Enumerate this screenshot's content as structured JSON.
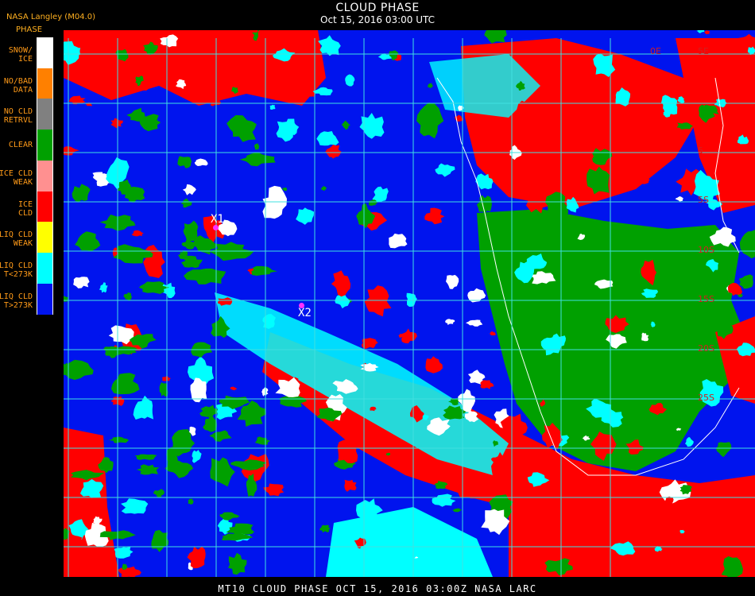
{
  "header": {
    "title": "CLOUD PHASE",
    "subtitle": "Oct 15, 2016 03:00 UTC",
    "producer": "NASA Langley (M04.0)"
  },
  "legend": {
    "heading": "PHASE",
    "items": [
      {
        "label": "SNOW/ ICE",
        "color": "#ffffff"
      },
      {
        "label": "NO/BAD DATA",
        "color": "#ff8000"
      },
      {
        "label": "NO CLD RETRVL",
        "color": "#808080"
      },
      {
        "label": "CLEAR",
        "color": "#00a000"
      },
      {
        "label": "ICE CLD WEAK",
        "color": "#ff9090"
      },
      {
        "label": "ICE CLD",
        "color": "#ff0000"
      },
      {
        "label": "LIQ CLD WEAK",
        "color": "#ffff00"
      },
      {
        "label": "LIQ CLD T<273K",
        "color": "#00ffff"
      },
      {
        "label": "LIQ CLD T>273K",
        "color": "#0014ee"
      }
    ]
  },
  "map": {
    "markers": [
      {
        "label": "X1",
        "color": "#ff30ff"
      },
      {
        "label": "X2",
        "color": "#ff30ff"
      }
    ],
    "lat_labels": [
      "5",
      "5S",
      "10S",
      "15S",
      "20S",
      "25S"
    ],
    "lon_labels": [
      "0E",
      "5E"
    ],
    "grid_color": "#40e0e0",
    "coast_color": "#ffffff"
  },
  "footer": {
    "text": "MT10  CLOUD PHASE   OCT 15, 2016 03:00Z   NASA LARC"
  }
}
